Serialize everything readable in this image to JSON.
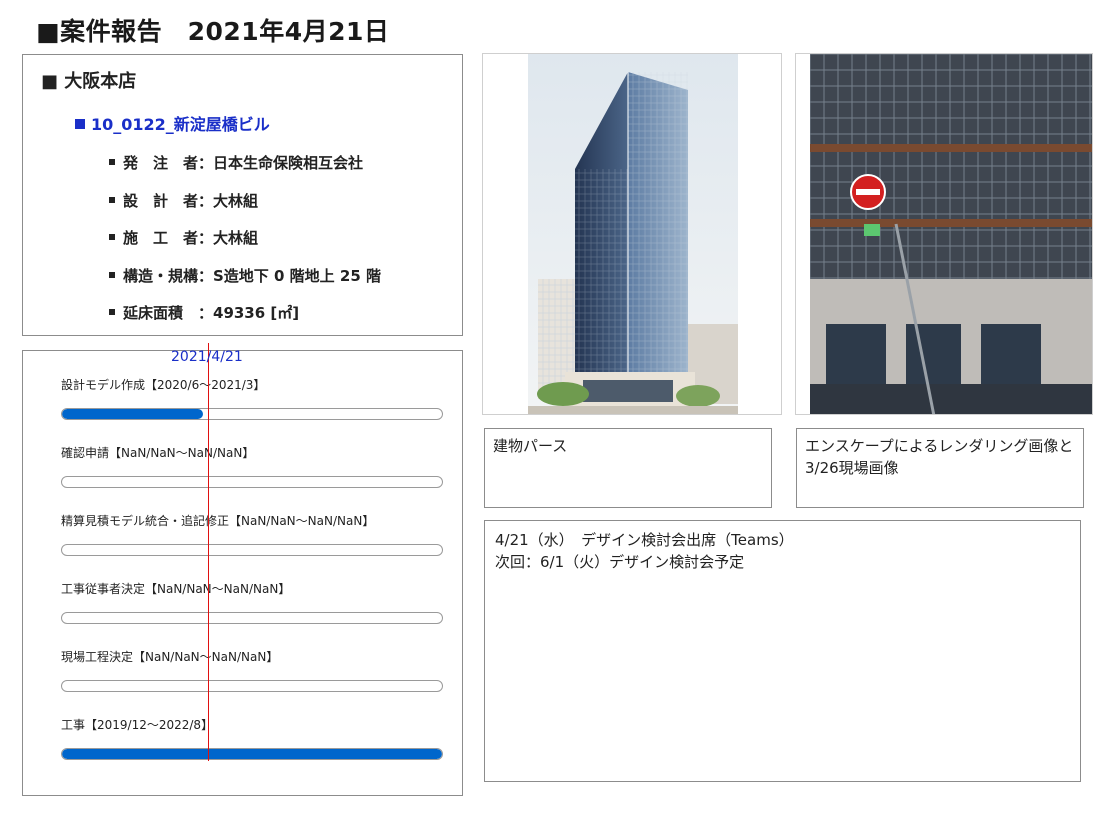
{
  "header": {
    "title": "■案件報告　2021年4月21日"
  },
  "info": {
    "branch": "■ 大阪本店",
    "project": "10_0122_新淀屋橋ビル",
    "details": [
      "発　注　者：日本生命保険相互会社",
      "設　計　者：大林組",
      "施　工　者：大林組",
      "構造・規構：S造地下 0 階地上 25 階",
      "延床面積　：49336 [㎡]"
    ]
  },
  "schedule": {
    "today_label": "2021/4/21",
    "tasks": [
      {
        "label": "設計モデル作成【2020/6～2021/3】",
        "progress": 0.37
      },
      {
        "label": "確認申請【NaN/NaN～NaN/NaN】",
        "progress": 0
      },
      {
        "label": "精算見積モデル統合・追記修正【NaN/NaN～NaN/NaN】",
        "progress": 0
      },
      {
        "label": "工事従事者決定【NaN/NaN～NaN/NaN】",
        "progress": 0
      },
      {
        "label": "現場工程決定【NaN/NaN～NaN/NaN】",
        "progress": 0
      },
      {
        "label": "工事【2019/12～2022/8】",
        "progress": 1.0
      }
    ]
  },
  "captions": {
    "left": "建物パース",
    "right": "エンスケープによるレンダリング画像と3/26現場画像"
  },
  "notes": [
    "4/21（水）　デザイン検討会出席（Teams）",
    "次回：6/1（火）デザイン検討会予定"
  ],
  "colors": {
    "accent_blue": "#1a2fc8",
    "bar_fill": "#0066cc",
    "today_line": "#e01010"
  }
}
